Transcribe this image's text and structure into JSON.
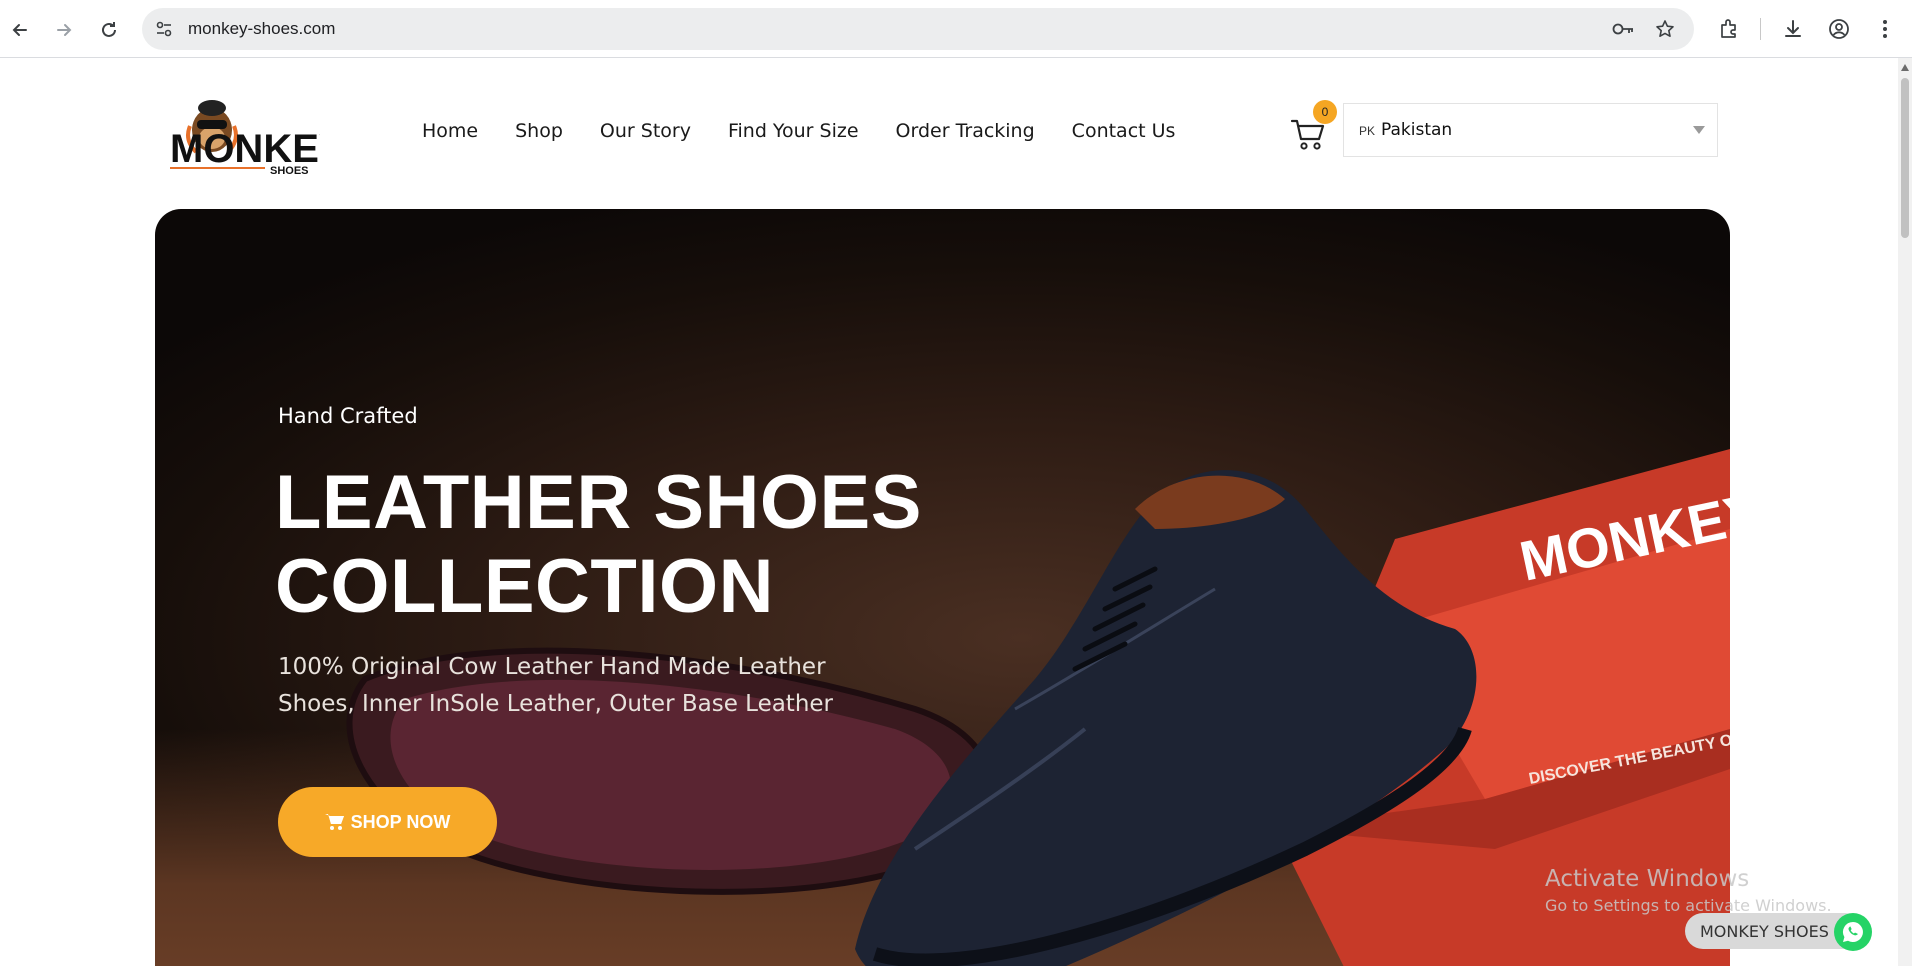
{
  "browser": {
    "url": "monkey-shoes.com"
  },
  "site": {
    "logo_text": "MONKEY",
    "logo_subtext": "SHOES",
    "nav": [
      {
        "label": "Home"
      },
      {
        "label": "Shop"
      },
      {
        "label": "Our Story"
      },
      {
        "label": "Find Your Size"
      },
      {
        "label": "Order Tracking"
      },
      {
        "label": "Contact Us"
      }
    ],
    "cart_count": "0",
    "country": {
      "code": "PK",
      "name": "Pakistan"
    }
  },
  "hero": {
    "eyebrow": "Hand Crafted",
    "title_line1": "LEATHER SHOES",
    "title_line2": "COLLECTION",
    "description": "100% Original Cow Leather Hand Made Leather Shoes, Inner InSole Leather, Outer Base Leather",
    "cta_label": "SHOP NOW",
    "box_logo_text": "MONKEY",
    "box_tagline": "DISCOVER THE BEAUTY OF"
  },
  "os_watermark": {
    "line1": "Activate Windows",
    "line2": "Go to Settings to activate Windows."
  },
  "whatsapp": {
    "label": "MONKEY SHOES"
  },
  "colors": {
    "accent": "#f7a928",
    "badge": "#f5a623",
    "whatsapp": "#25d366",
    "hero_bg": "#2e1c14",
    "box_red": "#d9412e"
  }
}
